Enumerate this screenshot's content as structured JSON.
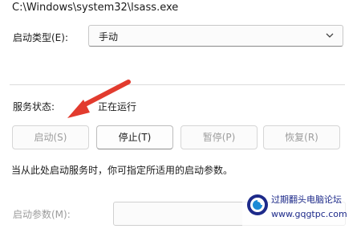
{
  "executable_path": "C:\\Windows\\system32\\lsass.exe",
  "startup_type": {
    "label": "启动类型(E):",
    "value": "手动"
  },
  "service_status": {
    "label": "服务状态:",
    "value": "正在运行"
  },
  "buttons": {
    "start": "启动(S)",
    "stop": "停止(T)",
    "pause": "暂停(P)",
    "resume": "恢复(R)"
  },
  "hint_text": "当从此处启动服务时，你可指定所适用的启动参数。",
  "start_params": {
    "label": "启动参数(M):",
    "value": ""
  },
  "watermark": {
    "line1": "过期翻头电脑论坛",
    "line2": "www.gqgtpc.com"
  },
  "colors": {
    "arrow": "#e23b2e",
    "watermark_text": "#1d2a8a",
    "disabled_text": "#9d9d9d"
  }
}
